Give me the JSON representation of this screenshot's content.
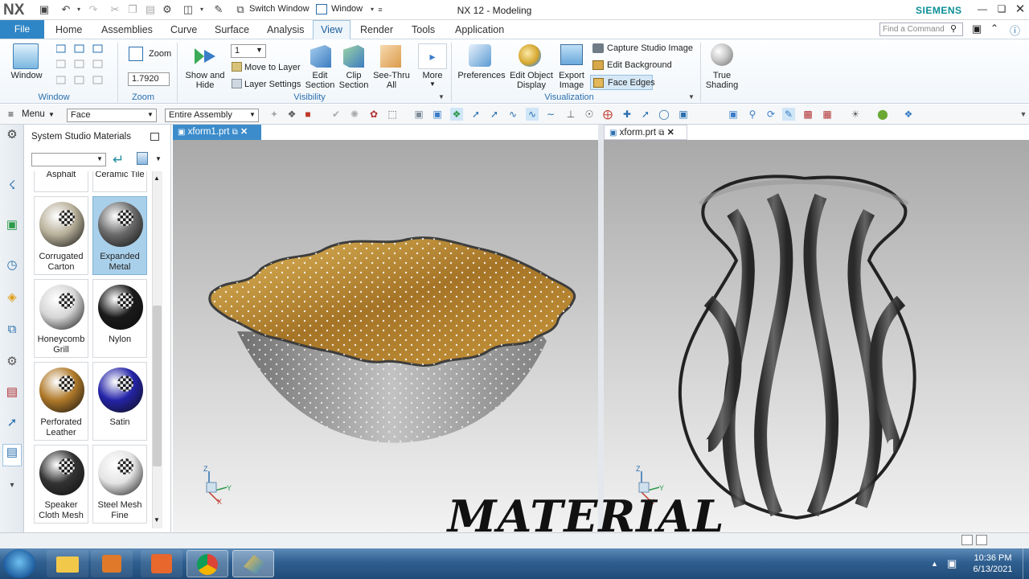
{
  "app": {
    "logo": "NX",
    "title": "NX 12 - Modeling",
    "brand": "SIEMENS",
    "switch_window": "Switch Window",
    "window_menu": "Window"
  },
  "tabs": [
    "File",
    "Home",
    "Assemblies",
    "Curve",
    "Surface",
    "Analysis",
    "View",
    "Render",
    "Tools",
    "Application"
  ],
  "active_tab": "View",
  "search": {
    "placeholder": "Find a Command"
  },
  "ribbon": {
    "window": {
      "label": "Window",
      "group": "Window"
    },
    "zoom": {
      "label": "Zoom",
      "value": "1.7920",
      "group": "Zoom"
    },
    "visibility": {
      "show_hide": "Show and Hide",
      "layer_value": "1",
      "move_to_layer": "Move to Layer",
      "layer_settings": "Layer Settings",
      "edit_section": "Edit Section",
      "clip_section": "Clip Section",
      "see_thru": "See-Thru All",
      "more": "More",
      "group": "Visibility"
    },
    "visualization": {
      "preferences": "Preferences",
      "edit_object_display": "Edit Object Display",
      "export_image": "Export Image",
      "capture_studio": "Capture Studio Image",
      "edit_background": "Edit Background",
      "face_edges": "Face Edges",
      "group": "Visualization"
    },
    "true_shading": "True Shading"
  },
  "command_bar": {
    "menu": "Menu",
    "filter": "Face",
    "scope": "Entire Assembly"
  },
  "materials_panel": {
    "title": "System Studio Materials",
    "top_row": [
      "Asphalt",
      "Ceramic Tile"
    ],
    "items": [
      {
        "label": "Corrugated Carton",
        "color": "#b8b09a",
        "selected": false
      },
      {
        "label": "Expanded Metal",
        "color": "#6a6a6a",
        "selected": true
      },
      {
        "label": "Honeycomb Grill",
        "color": "#d6d6d6",
        "selected": false
      },
      {
        "label": "Nylon",
        "color": "#1a1a1a",
        "selected": false
      },
      {
        "label": "Perforated Leather",
        "color": "#b07a2a",
        "selected": false
      },
      {
        "label": "Satin",
        "color": "#2424a8",
        "selected": false
      },
      {
        "label": "Speaker Cloth Mesh",
        "color": "#333333",
        "selected": false
      },
      {
        "label": "Steel Mesh Fine",
        "color": "#e4e4e4",
        "selected": false
      }
    ]
  },
  "viewports": [
    {
      "tab": "xform1.prt",
      "active": true
    },
    {
      "tab": "xform.prt",
      "active": false
    }
  ],
  "axes": {
    "x": "X",
    "y": "Y",
    "z": "Z"
  },
  "caption": "MATERIAL",
  "taskbar": {
    "time": "10:36 PM",
    "date": "6/13/2021"
  },
  "colors": {
    "accent": "#2f86c6",
    "bowl_inner": "#a87a2c",
    "bowl_outer": "#9a9a9a"
  }
}
